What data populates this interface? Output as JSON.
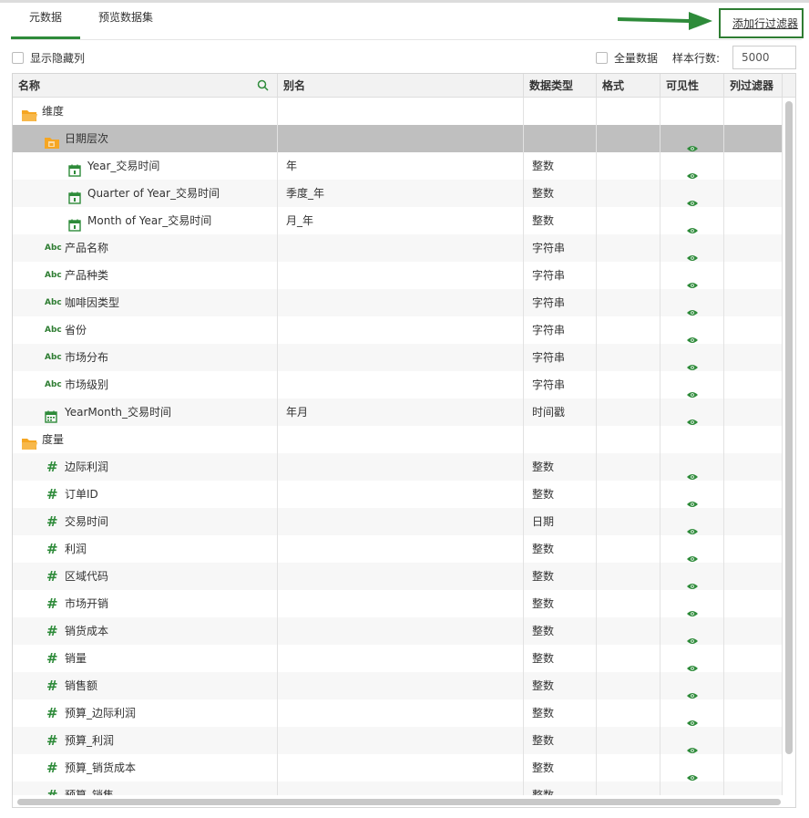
{
  "tabs": [
    {
      "label": "元数据",
      "active": true
    },
    {
      "label": "预览数据集",
      "active": false
    }
  ],
  "add_filter_label": "添加行过滤器",
  "options": {
    "show_hidden_label": "显示隐藏列",
    "all_data_label": "全量数据",
    "sample_rows_label": "样本行数:",
    "sample_rows_value": "5000"
  },
  "columns": [
    "名称",
    "别名",
    "数据类型",
    "格式",
    "可见性",
    "列过滤器"
  ],
  "colors": {
    "accent": "#2e8b3a",
    "folder": "#f5a623",
    "selected_row": "#bfbfbf"
  },
  "rows": [
    {
      "icon": "folder-icon",
      "name": "维度",
      "alias": "",
      "type": "",
      "visible": false
    },
    {
      "icon": "hierarchy-folder-icon",
      "name": "日期层次",
      "alias": "",
      "type": "",
      "visible": true,
      "selected": true
    },
    {
      "icon": "calendar-icon",
      "name": "Year_交易时间",
      "alias": "年",
      "type": "整数",
      "visible": true
    },
    {
      "icon": "calendar-icon",
      "name": "Quarter of Year_交易时间",
      "alias": "季度_年",
      "type": "整数",
      "visible": true
    },
    {
      "icon": "calendar-icon",
      "name": "Month of Year_交易时间",
      "alias": "月_年",
      "type": "整数",
      "visible": true
    },
    {
      "icon": "abc-icon",
      "name": "产品名称",
      "alias": "",
      "type": "字符串",
      "visible": true
    },
    {
      "icon": "abc-icon",
      "name": "产品种类",
      "alias": "",
      "type": "字符串",
      "visible": true
    },
    {
      "icon": "abc-icon",
      "name": "咖啡因类型",
      "alias": "",
      "type": "字符串",
      "visible": true
    },
    {
      "icon": "abc-icon",
      "name": "省份",
      "alias": "",
      "type": "字符串",
      "visible": true
    },
    {
      "icon": "abc-icon",
      "name": "市场分布",
      "alias": "",
      "type": "字符串",
      "visible": true
    },
    {
      "icon": "abc-icon",
      "name": "市场级别",
      "alias": "",
      "type": "字符串",
      "visible": true
    },
    {
      "icon": "timestamp-icon",
      "name": "YearMonth_交易时间",
      "alias": "年月",
      "type": "时间戳",
      "visible": true
    },
    {
      "icon": "folder-icon",
      "name": "度量",
      "alias": "",
      "type": "",
      "visible": false
    },
    {
      "icon": "hash-icon",
      "name": "边际利润",
      "alias": "",
      "type": "整数",
      "visible": true
    },
    {
      "icon": "hash-icon",
      "name": "订单ID",
      "alias": "",
      "type": "整数",
      "visible": true
    },
    {
      "icon": "hash-icon",
      "name": "交易时间",
      "alias": "",
      "type": "日期",
      "visible": true
    },
    {
      "icon": "hash-icon",
      "name": "利润",
      "alias": "",
      "type": "整数",
      "visible": true
    },
    {
      "icon": "hash-icon",
      "name": "区域代码",
      "alias": "",
      "type": "整数",
      "visible": true
    },
    {
      "icon": "hash-icon",
      "name": "市场开销",
      "alias": "",
      "type": "整数",
      "visible": true
    },
    {
      "icon": "hash-icon",
      "name": "销货成本",
      "alias": "",
      "type": "整数",
      "visible": true
    },
    {
      "icon": "hash-icon",
      "name": "销量",
      "alias": "",
      "type": "整数",
      "visible": true
    },
    {
      "icon": "hash-icon",
      "name": "销售额",
      "alias": "",
      "type": "整数",
      "visible": true
    },
    {
      "icon": "hash-icon",
      "name": "预算_边际利润",
      "alias": "",
      "type": "整数",
      "visible": true
    },
    {
      "icon": "hash-icon",
      "name": "预算_利润",
      "alias": "",
      "type": "整数",
      "visible": true
    },
    {
      "icon": "hash-icon",
      "name": "预算_销货成本",
      "alias": "",
      "type": "整数",
      "visible": true
    },
    {
      "icon": "hash-icon",
      "name": "预算_销售",
      "alias": "",
      "type": "整数",
      "visible": true
    }
  ]
}
